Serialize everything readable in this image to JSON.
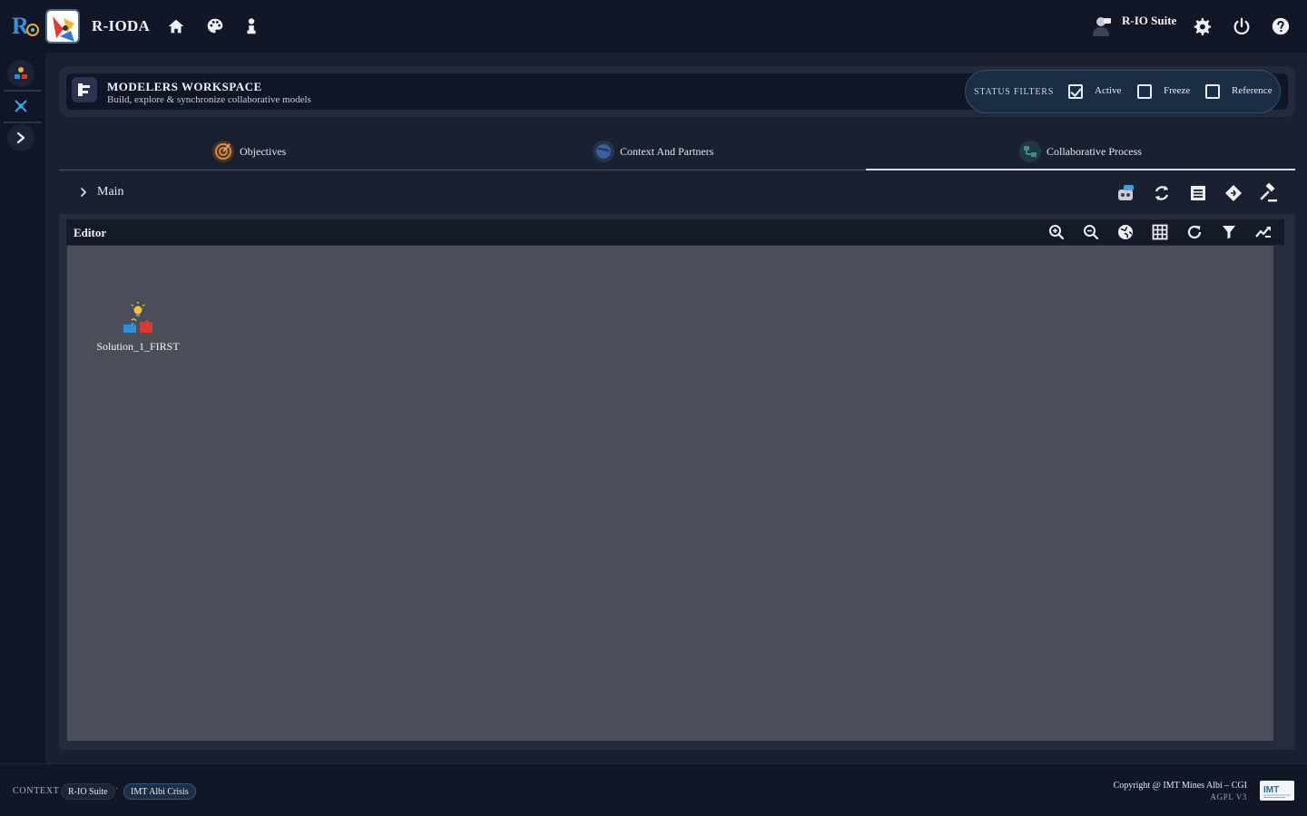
{
  "app": {
    "title": "R-IODA",
    "user_name": "R-IO Suite"
  },
  "workspace": {
    "title": "MODELERS WORKSPACE",
    "subtitle": "Build, explore & synchronize collaborative models"
  },
  "status_filters": {
    "label": "STATUS FILTERS",
    "options": [
      {
        "label": "Active",
        "checked": true
      },
      {
        "label": "Freeze",
        "checked": false
      },
      {
        "label": "Reference",
        "checked": false
      }
    ]
  },
  "tabs": [
    {
      "label": "Objectives",
      "icon": "target-icon",
      "active": false
    },
    {
      "label": "Context And Partners",
      "icon": "globe-icon",
      "active": false
    },
    {
      "label": "Collaborative Process",
      "icon": "process-icon",
      "active": true
    }
  ],
  "breadcrumb": {
    "label": "Main"
  },
  "editor": {
    "title": "Editor",
    "nodes": [
      {
        "label": "Solution_1_FIRST",
        "icon": "solution-puzzle-icon"
      }
    ]
  },
  "footer": {
    "context_label": "CONTEXT",
    "chip_suite": "R-IO Suite",
    "chip_separator": "·",
    "chip_crisis": "IMT Albi Crisis",
    "copyright": "Copyright @ IMT Mines Albi – CGI",
    "license": "AGPL V3"
  },
  "colors": {
    "background": "#151a2a",
    "topbar": "#121727",
    "canvas": "#4a4e59",
    "filter_accent": "#2f4e6e"
  }
}
